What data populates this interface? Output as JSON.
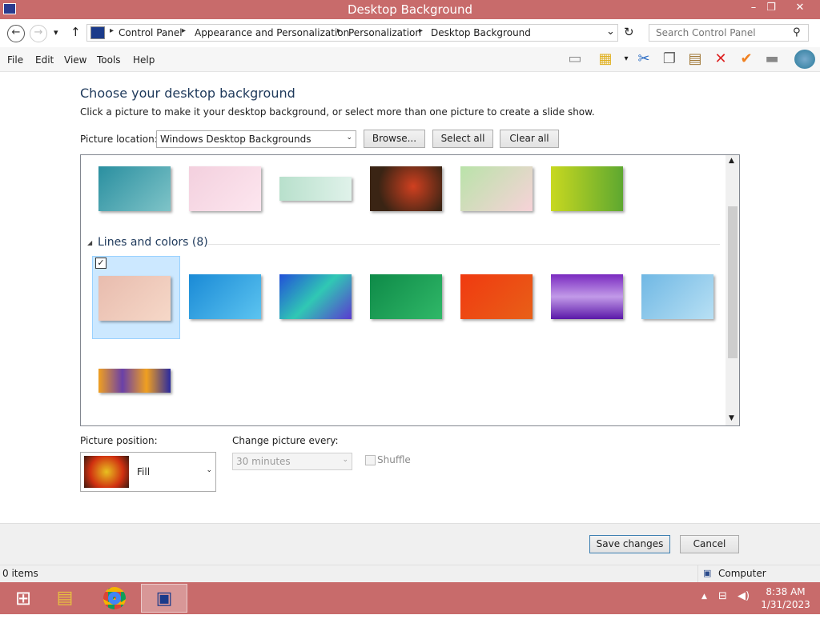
{
  "window": {
    "title": "Desktop Background",
    "minimize": "–",
    "maximize": "❐",
    "close": "✕"
  },
  "nav": {
    "back": "←",
    "forward": "→",
    "recent": "▾",
    "up": "↑",
    "refresh": "↻",
    "dropdown": "⌄"
  },
  "breadcrumb": [
    "Control Panel",
    "Appearance and Personalization",
    "Personalization",
    "Desktop Background"
  ],
  "search": {
    "placeholder": "Search Control Panel"
  },
  "menu": [
    "File",
    "Edit",
    "View",
    "Tools",
    "Help"
  ],
  "toolbar_icons": [
    "layout-icon",
    "properties-icon",
    "cut-icon",
    "copy-icon",
    "paste-icon",
    "delete-icon",
    "check-icon",
    "rename-icon",
    "globe-icon"
  ],
  "main": {
    "heading": "Choose your desktop background",
    "subtitle": "Click a picture to make it your desktop background, or select more than one picture to create a slide show.",
    "picture_location_label": "Picture location:",
    "picture_location_value": "Windows Desktop Backgrounds",
    "browse": "Browse...",
    "select_all": "Select all",
    "clear_all": "Clear all",
    "group_label": "Lines and colors (8)",
    "picture_position_label": "Picture position:",
    "picture_position_value": "Fill",
    "change_every_label": "Change picture every:",
    "change_every_value": "30 minutes",
    "shuffle_label": "Shuffle",
    "save": "Save changes",
    "cancel": "Cancel"
  },
  "status": {
    "items": "0 items",
    "location": "Computer"
  },
  "clock": {
    "time": "8:38 AM",
    "date": "1/31/2023"
  },
  "colors": {
    "titlebar": "#c86b6b",
    "selection": "#cce8ff",
    "heading": "#1e395b"
  }
}
